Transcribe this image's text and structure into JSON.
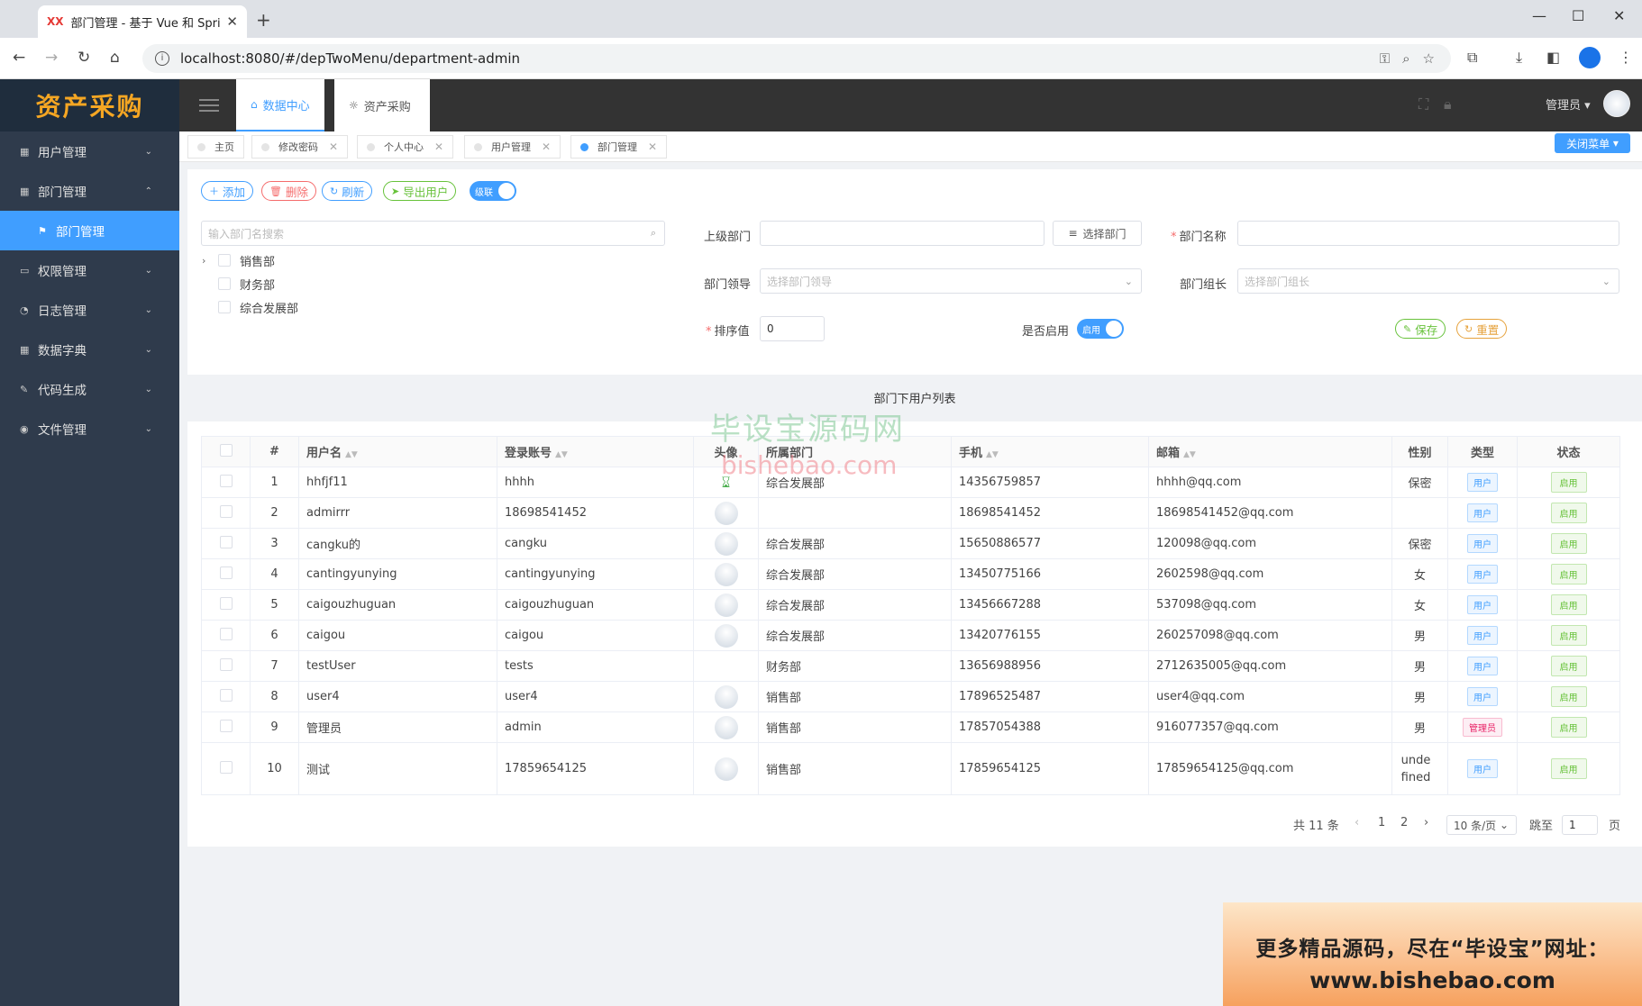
{
  "browser": {
    "tab_title": "部门管理 - 基于 Vue 和 Spring",
    "tab_fav": "XX",
    "url": "localhost:8080/#/depTwoMenu/department-admin"
  },
  "app": {
    "logo": "资产采购",
    "top_tabs": [
      {
        "label": "数据中心",
        "active": true
      },
      {
        "label": "资产采购",
        "active": false
      }
    ],
    "user": "管理员"
  },
  "sidebar": {
    "items": [
      {
        "label": "用户管理",
        "icon": "table-icon"
      },
      {
        "label": "部门管理",
        "icon": "grid-icon"
      },
      {
        "label": "部门管理",
        "icon": "flag-icon"
      },
      {
        "label": "权限管理",
        "icon": "monitor-icon"
      },
      {
        "label": "日志管理",
        "icon": "pie-icon"
      },
      {
        "label": "数据字典",
        "icon": "grid-icon"
      },
      {
        "label": "代码生成",
        "icon": "pen-icon"
      },
      {
        "label": "文件管理",
        "icon": "globe-icon"
      }
    ]
  },
  "page_tabs": [
    "主页",
    "修改密码",
    "个人中心",
    "用户管理",
    "部门管理"
  ],
  "close_menu": "关闭菜单",
  "toolbar": {
    "add": "添加",
    "delete": "删除",
    "refresh": "刷新",
    "export": "导出用户",
    "cascade": "级联"
  },
  "tree": {
    "search_placeholder": "输入部门名搜索",
    "nodes": [
      "销售部",
      "财务部",
      "综合发展部"
    ]
  },
  "form": {
    "parent_label": "上级部门",
    "select_dept": "选择部门",
    "name_label": "部门名称",
    "leader_label": "部门领导",
    "leader_placeholder": "选择部门领导",
    "head_label": "部门组长",
    "head_placeholder": "选择部门组长",
    "sort_label": "排序值",
    "sort_value": "0",
    "enable_label": "是否启用",
    "enable_switch": "启用",
    "save": "保存",
    "reset": "重置"
  },
  "list_title": "部门下用户列表",
  "watermark": {
    "line1": "毕设宝源码网",
    "line2": "bishebao.com"
  },
  "table": {
    "headers": [
      "#",
      "用户名",
      "登录账号",
      "头像",
      "所属部门",
      "手机",
      "邮箱",
      "性别",
      "类型",
      "状态"
    ],
    "rows": [
      {
        "no": "1",
        "username": "hhfjf11",
        "account": "hhhh",
        "avatar": "hourglass",
        "dept": "综合发展部",
        "phone": "14356759857",
        "email": "hhhh@qq.com",
        "gender": "保密",
        "type": "用户",
        "status": "启用"
      },
      {
        "no": "2",
        "username": "admirrr",
        "account": "18698541452",
        "avatar": "default",
        "dept": "",
        "phone": "18698541452",
        "email": "18698541452@qq.com",
        "gender": "",
        "type": "用户",
        "status": "启用"
      },
      {
        "no": "3",
        "username": "cangku的",
        "account": "cangku",
        "avatar": "default",
        "dept": "综合发展部",
        "phone": "15650886577",
        "email": "120098@qq.com",
        "gender": "保密",
        "type": "用户",
        "status": "启用"
      },
      {
        "no": "4",
        "username": "cantingyunying",
        "account": "cantingyunying",
        "avatar": "default",
        "dept": "综合发展部",
        "phone": "13450775166",
        "email": "2602598@qq.com",
        "gender": "女",
        "type": "用户",
        "status": "启用"
      },
      {
        "no": "5",
        "username": "caigouzhuguan",
        "account": "caigouzhuguan",
        "avatar": "default",
        "dept": "综合发展部",
        "phone": "13456667288",
        "email": "537098@qq.com",
        "gender": "女",
        "type": "用户",
        "status": "启用"
      },
      {
        "no": "6",
        "username": "caigou",
        "account": "caigou",
        "avatar": "default",
        "dept": "综合发展部",
        "phone": "13420776155",
        "email": "260257098@qq.com",
        "gender": "男",
        "type": "用户",
        "status": "启用"
      },
      {
        "no": "7",
        "username": "testUser",
        "account": "tests",
        "avatar": "none",
        "dept": "财务部",
        "phone": "13656988956",
        "email": "2712635005@qq.com",
        "gender": "男",
        "type": "用户",
        "status": "启用"
      },
      {
        "no": "8",
        "username": "user4",
        "account": "user4",
        "avatar": "default",
        "dept": "销售部",
        "phone": "17896525487",
        "email": "user4@qq.com",
        "gender": "男",
        "type": "用户",
        "status": "启用"
      },
      {
        "no": "9",
        "username": "管理员",
        "account": "admin",
        "avatar": "default",
        "dept": "销售部",
        "phone": "17857054388",
        "email": "916077357@qq.com",
        "gender": "男",
        "type": "管理员",
        "status": "启用"
      },
      {
        "no": "10",
        "username": "测试",
        "account": "17859654125",
        "avatar": "default",
        "dept": "销售部",
        "phone": "17859654125",
        "email": "17859654125@qq.com",
        "gender": "undefined",
        "type": "用户",
        "status": "启用"
      }
    ]
  },
  "pagination": {
    "total": "共 11 条",
    "pages": [
      "1",
      "2"
    ],
    "page_size": "10 条/页",
    "jump_label": "跳至",
    "jump_value": "1",
    "page_suffix": "页"
  },
  "banner": {
    "line1": "更多精品源码，尽在“毕设宝”网址：",
    "line2": "www.bishebao.com"
  }
}
